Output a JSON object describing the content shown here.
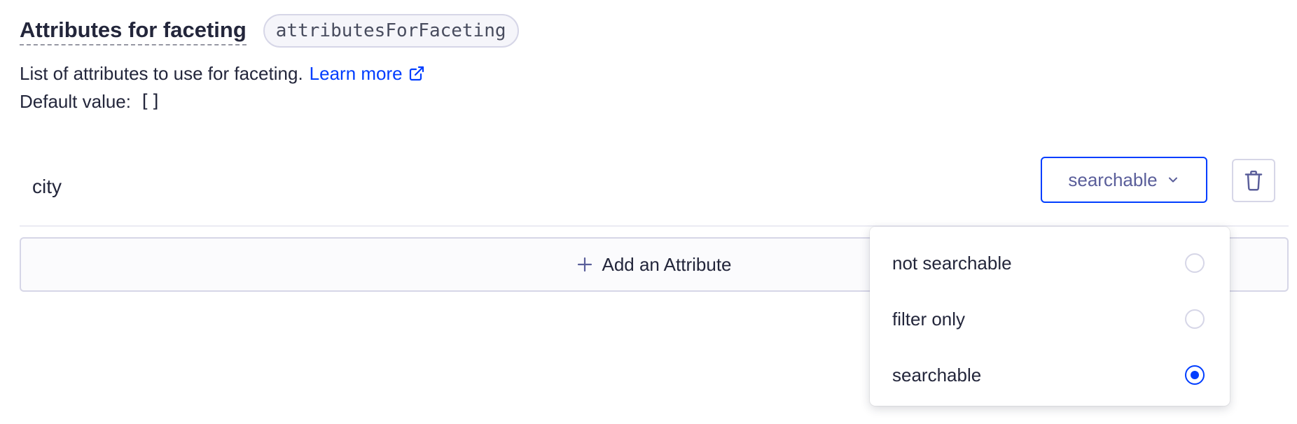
{
  "section": {
    "title": "Attributes for faceting",
    "param_name": "attributesForFaceting",
    "description": "List of attributes to use for faceting.",
    "learn_more_label": "Learn more",
    "default_label": "Default value:",
    "default_value": "[]"
  },
  "attribute": {
    "name": "city",
    "mode": "searchable"
  },
  "add_button_label": "Add an Attribute",
  "dropdown": {
    "options": [
      {
        "label": "not searchable",
        "selected": false
      },
      {
        "label": "filter only",
        "selected": false
      },
      {
        "label": "searchable",
        "selected": true
      }
    ]
  },
  "colors": {
    "accent": "#003dff",
    "text": "#23263b",
    "border": "#d6d6e7",
    "muted": "#5a5e9a"
  },
  "icons": {
    "learn_more": "external-link-icon",
    "select": "chevron-down-icon",
    "delete": "trash-icon",
    "add": "plus-icon"
  }
}
